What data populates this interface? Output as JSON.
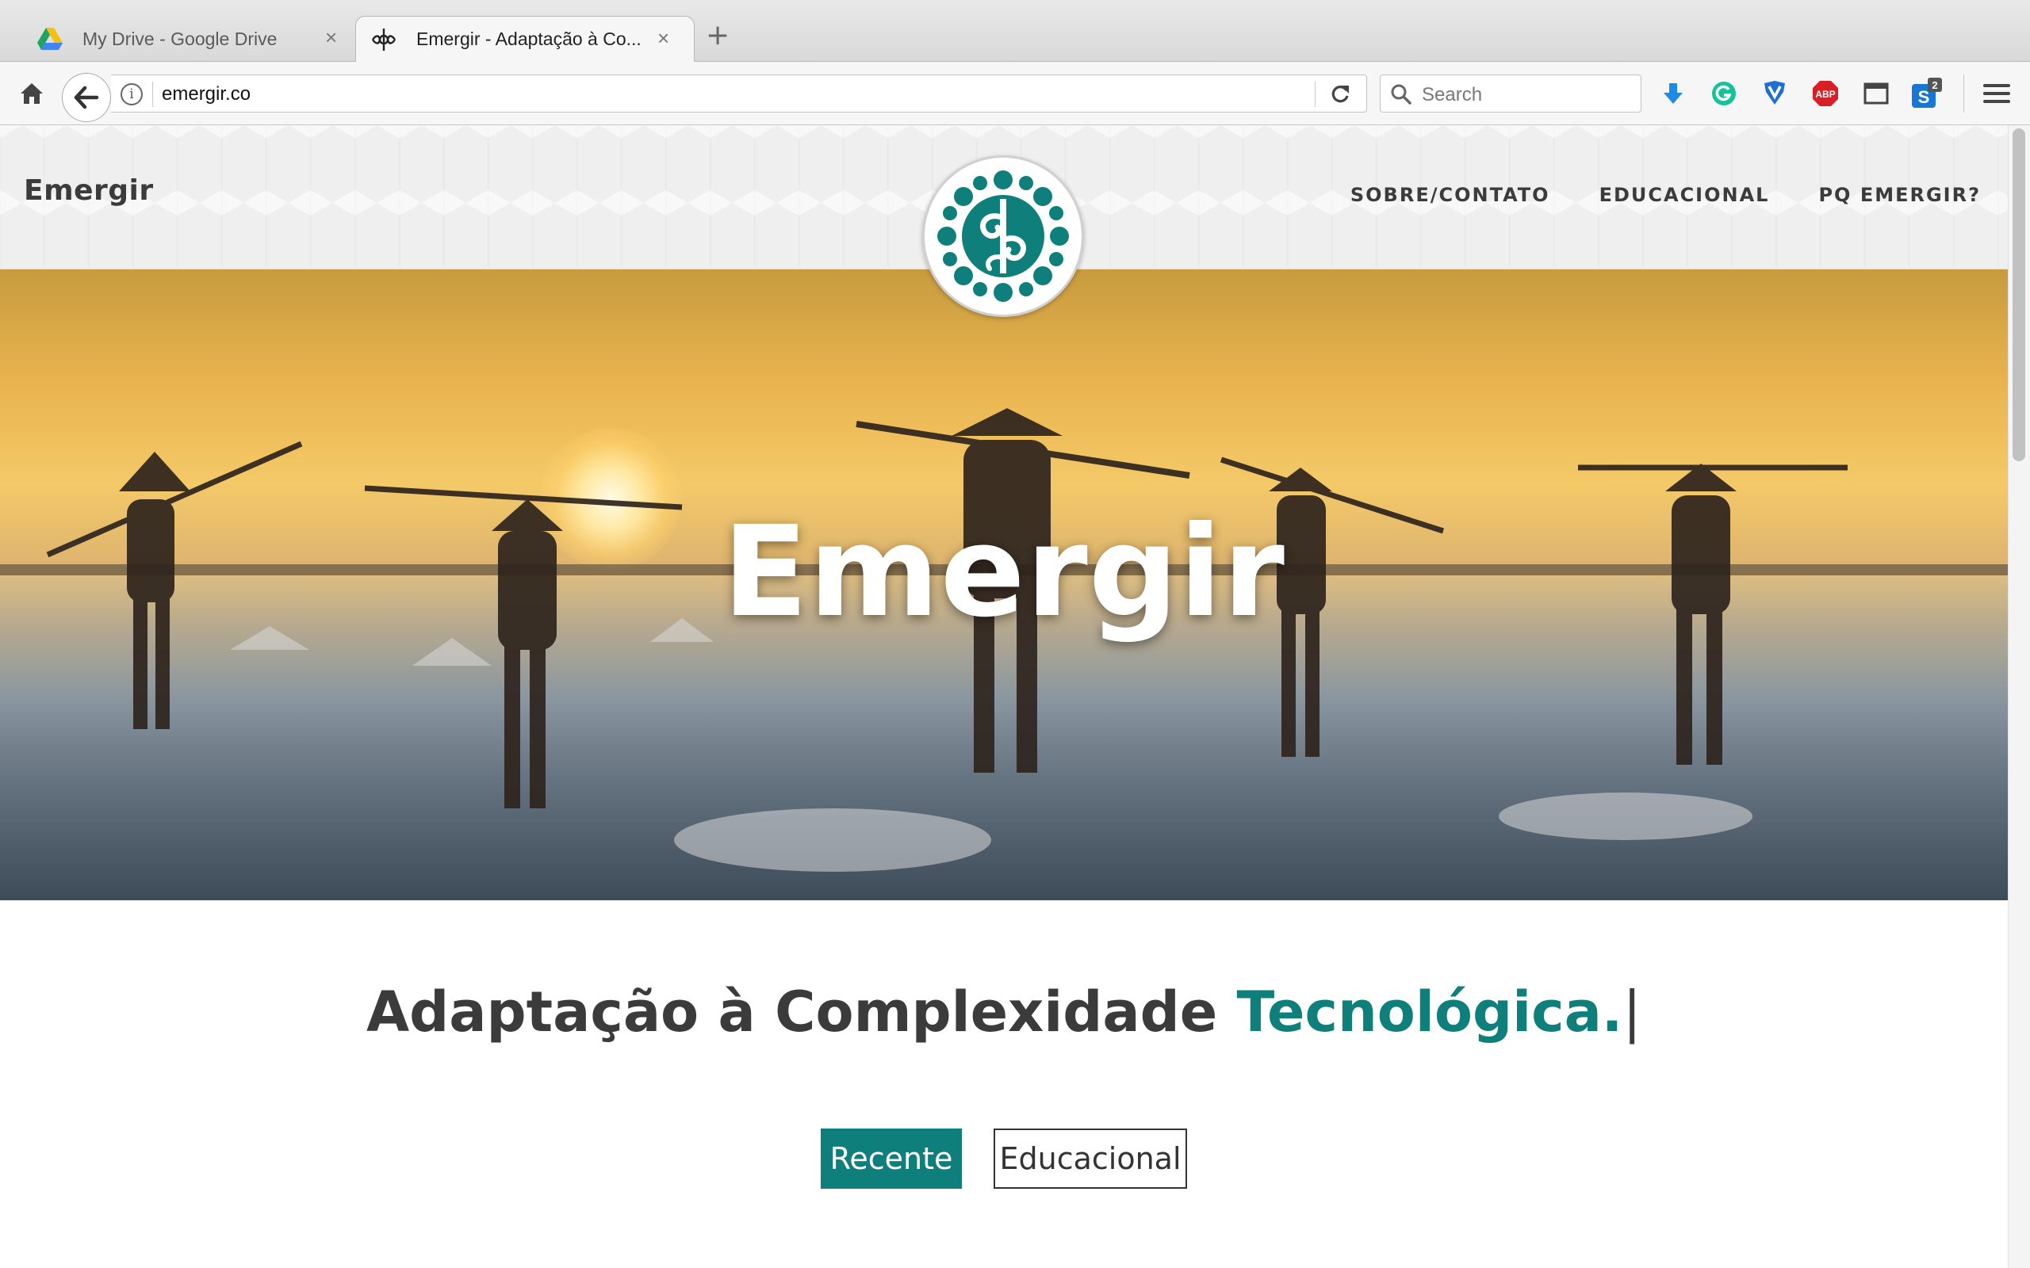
{
  "browser": {
    "tabs": [
      {
        "title": "My Drive - Google Drive",
        "icon": "google-drive-icon",
        "active": false
      },
      {
        "title": "Emergir - Adaptação à Co...",
        "icon": "emergir-favicon-icon",
        "active": true
      }
    ],
    "new_tab_label": "+",
    "close_glyph": "×",
    "url": "emergir.co",
    "search_placeholder": "Search",
    "extension_badge": "2",
    "abp_label": "ABP"
  },
  "site": {
    "brand": "Emergir",
    "nav": [
      "SOBRE/CONTATO",
      "EDUCACIONAL",
      "PQ EMERGIR?"
    ],
    "hero_title": "Emergir",
    "tagline": {
      "main": "Adaptação à Complexidade ",
      "accent": "Tecnológica.",
      "cursor": "|"
    },
    "filters": [
      {
        "label": "Recente",
        "active": true
      },
      {
        "label": "Educacional",
        "active": false
      }
    ]
  },
  "colors": {
    "accent": "#0f7f7b",
    "text_dark": "#3b3b3b"
  }
}
